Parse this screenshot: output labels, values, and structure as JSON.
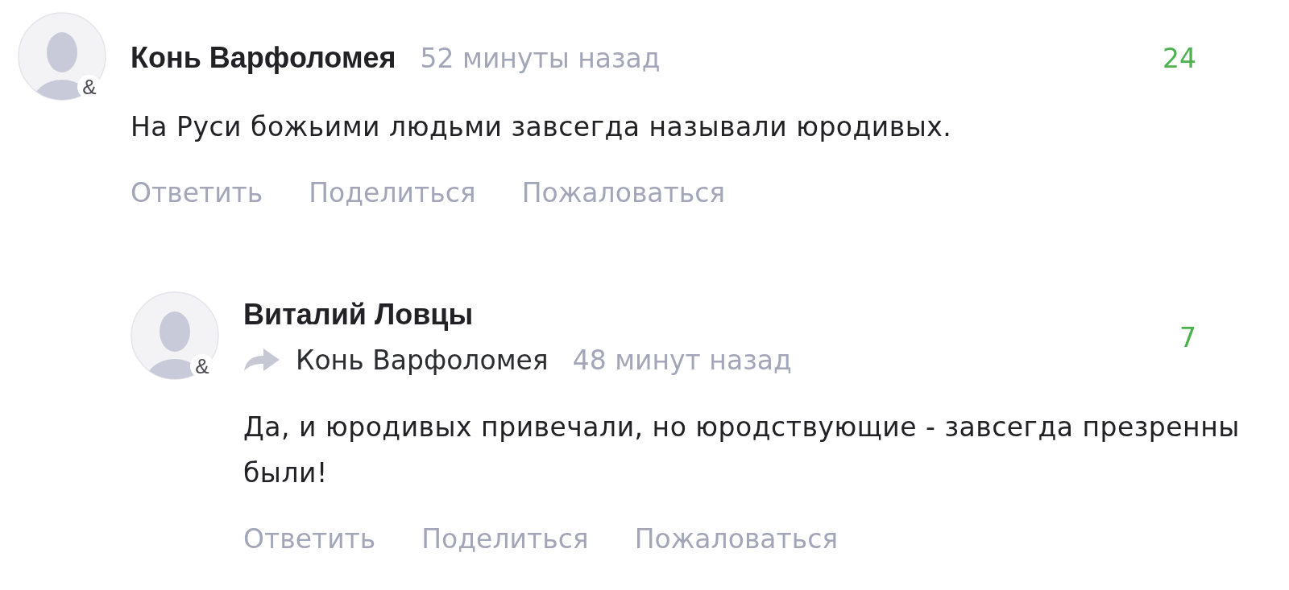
{
  "comments": [
    {
      "author": "Конь Варфоломея",
      "avatar_badge": "&",
      "time": "52 минуты назад",
      "rating": "24",
      "text": "На Руси божьими людьми завсегда называли юродивых.",
      "actions": [
        "Ответить",
        "Поделиться",
        "Пожаловаться"
      ],
      "replies": [
        {
          "author": "Виталий Ловцы",
          "avatar_badge": "&",
          "reply_to": "Конь Варфоломея",
          "time": "48 минут назад",
          "rating": "7",
          "text": "Да, и юродивых привечали, но юродствующие - завсегда презренны были!",
          "actions": [
            "Ответить",
            "Поделиться",
            "Пожаловаться"
          ]
        }
      ]
    }
  ]
}
